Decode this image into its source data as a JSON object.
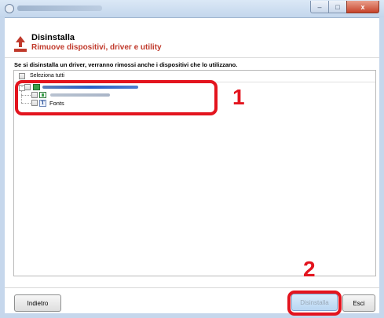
{
  "window": {
    "minimize_icon": "minimize-icon",
    "maximize_icon": "maximize-icon",
    "close_icon": "close-icon",
    "close_glyph": "x"
  },
  "header": {
    "title": "Disinstalla",
    "subtitle": "Rimuove dispositivi, driver e utility",
    "icon": "uninstall-arrow-icon",
    "accent_color": "#c0392b"
  },
  "info_text": "Se si disinstalla un driver, verranno rimossi anche i dispositivi che lo utilizzano.",
  "list": {
    "select_all_label": "Seleziona tutti",
    "items": [
      {
        "label": "",
        "icon": "device-icon",
        "checked": false,
        "expanded": true
      },
      {
        "label": "",
        "icon": "driver-icon",
        "checked": false
      },
      {
        "label": "Fonts",
        "icon": "font-icon",
        "checked": false
      }
    ],
    "font_icon_glyph": "T"
  },
  "annotations": {
    "callout_1": "1",
    "callout_2": "2",
    "color": "#e3141e"
  },
  "footer": {
    "back_label": "Indietro",
    "uninstall_label": "Disinstalla",
    "exit_label": "Esci"
  }
}
